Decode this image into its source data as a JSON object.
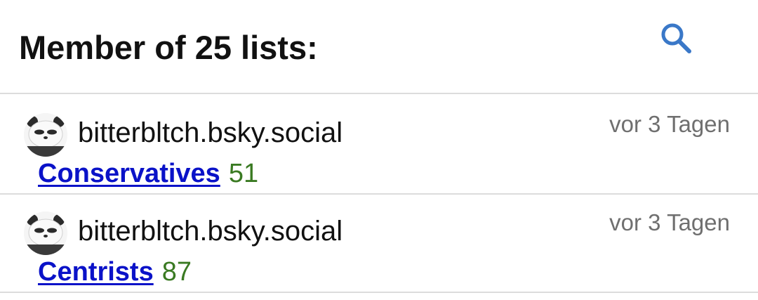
{
  "header": {
    "title": "Member of 25 lists:",
    "search_icon": "search-icon",
    "accent_color": "#3a78c8"
  },
  "lists": [
    {
      "author": "bitterbltch.bsky.social",
      "time": "vor 3 Tagen",
      "name": "Conservatives",
      "count": "51",
      "avatar_icon": "panda-avatar"
    },
    {
      "author": "bitterbltch.bsky.social",
      "time": "vor 3 Tagen",
      "name": "Centrists",
      "count": "87",
      "avatar_icon": "panda-avatar"
    }
  ],
  "colors": {
    "link": "#0a12c8",
    "count": "#3a7a22",
    "muted": "#6f6f6f",
    "divider": "#dcdcdc"
  }
}
